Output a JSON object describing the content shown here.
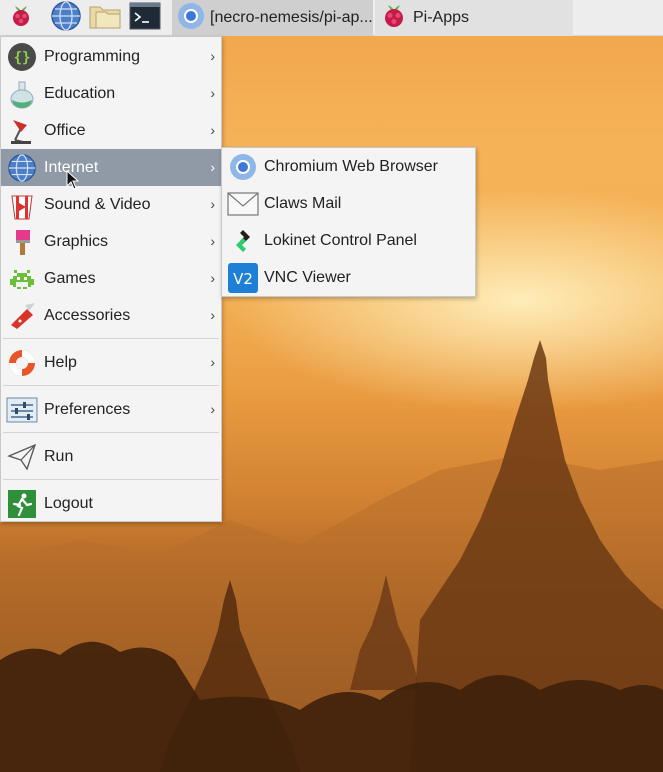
{
  "taskbar": {
    "launchers": [
      {
        "icon": "raspberry-icon"
      },
      {
        "icon": "globe-icon"
      },
      {
        "icon": "folder-icon"
      },
      {
        "icon": "terminal-icon"
      }
    ],
    "tasks": [
      {
        "label": "[necro-nemesis/pi-ap...",
        "icon": "chromium-icon"
      },
      {
        "label": "Pi-Apps",
        "icon": "raspberry-icon"
      }
    ]
  },
  "main_menu": {
    "items": [
      {
        "label": "Programming",
        "icon": "programming-icon"
      },
      {
        "label": "Education",
        "icon": "flask-icon"
      },
      {
        "label": "Office",
        "icon": "lamp-icon"
      },
      {
        "label": "Internet",
        "icon": "globe-icon"
      },
      {
        "label": "Sound & Video",
        "icon": "popcorn-icon"
      },
      {
        "label": "Graphics",
        "icon": "paintbrush-icon"
      },
      {
        "label": "Games",
        "icon": "invader-icon"
      },
      {
        "label": "Accessories",
        "icon": "knife-icon"
      },
      {
        "label": "Help",
        "icon": "lifebuoy-icon"
      },
      {
        "label": "Preferences",
        "icon": "sliders-icon"
      },
      {
        "label": "Run",
        "icon": "paper-plane-icon"
      },
      {
        "label": "Logout",
        "icon": "exit-icon"
      }
    ]
  },
  "internet_submenu": {
    "items": [
      {
        "label": "Chromium Web Browser",
        "icon": "chromium-icon"
      },
      {
        "label": "Claws Mail",
        "icon": "envelope-icon"
      },
      {
        "label": "Lokinet Control Panel",
        "icon": "lokinet-icon"
      },
      {
        "label": "VNC Viewer",
        "icon": "vnc-icon"
      }
    ]
  },
  "colors": {
    "hover": "#8f9aa6",
    "menu_bg": "#f4f4f4"
  }
}
